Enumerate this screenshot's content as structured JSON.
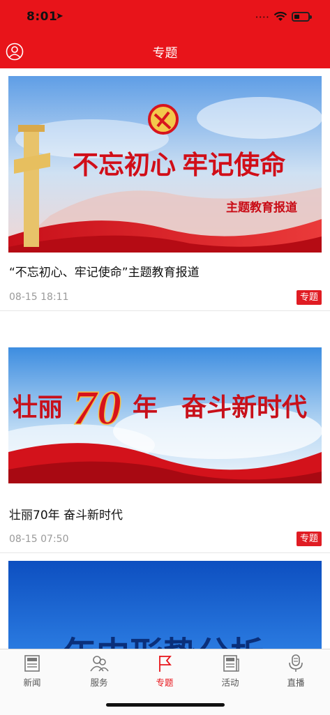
{
  "status_bar": {
    "time": "8:01",
    "signal_dots": "••••"
  },
  "header": {
    "title": "专题"
  },
  "articles": [
    {
      "banner_main": "不忘初心  牢记使命",
      "banner_sub": "主题教育报道",
      "title": "“不忘初心、牢记使命”主题教育报道",
      "date": "08-15 18:11",
      "tag": "专题"
    },
    {
      "banner_left": "壮丽",
      "banner_num": "70",
      "banner_year": "年",
      "banner_right": "奋斗新时代",
      "title": "壮丽70年 奋斗新时代",
      "date": "08-15 07:50",
      "tag": "专题"
    },
    {
      "banner_partial": "年中形势分析"
    }
  ],
  "tabbar": {
    "items": [
      {
        "label": "新闻",
        "icon": "news-icon",
        "active": false
      },
      {
        "label": "服务",
        "icon": "people-icon",
        "active": false
      },
      {
        "label": "专题",
        "icon": "flag-icon",
        "active": true
      },
      {
        "label": "活动",
        "icon": "newspaper-icon",
        "active": false
      },
      {
        "label": "直播",
        "icon": "microphone-icon",
        "active": false
      }
    ]
  },
  "colors": {
    "brand_red": "#e8141a",
    "tag_red": "#e01c23",
    "date_gray": "#9a9a9a"
  }
}
